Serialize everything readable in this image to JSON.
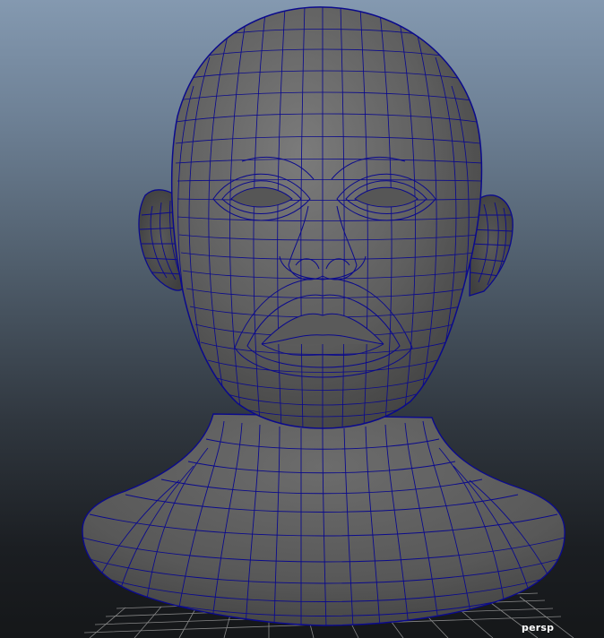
{
  "viewport": {
    "camera_label": "persp",
    "display_mode": "smooth-shaded-with-wireframe",
    "colors": {
      "background_top": "#8499b0",
      "background_bottom": "#151719",
      "mesh_fill": "#6a6a6a",
      "wireframe": "#0b0a8c",
      "grid": "#9a9a9a"
    }
  },
  "scene": {
    "object": "head-bust-mesh",
    "grid_visible": true
  }
}
